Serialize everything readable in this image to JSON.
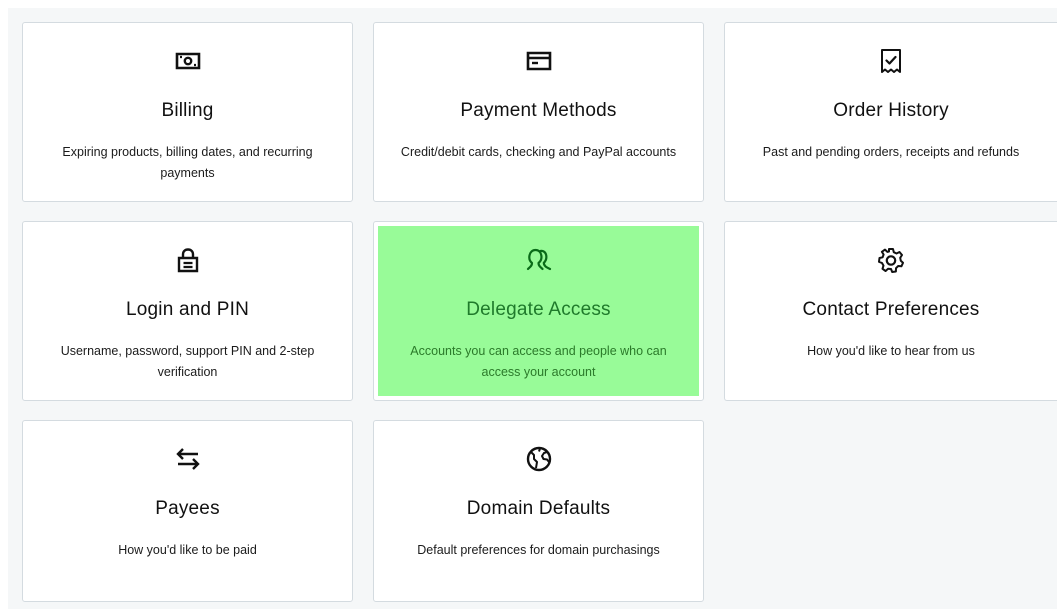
{
  "cards": [
    {
      "title": "Billing",
      "description": "Expiring products, billing dates, and recurring payments",
      "icon": "cash-icon"
    },
    {
      "title": "Payment Methods",
      "description": "Credit/debit cards, checking and PayPal accounts",
      "icon": "credit-card-icon"
    },
    {
      "title": "Order History",
      "description": "Past and pending orders, receipts and refunds",
      "icon": "receipt-check-icon"
    },
    {
      "title": "Login and PIN",
      "description": "Username, password, support PIN and 2-step verification",
      "icon": "lock-icon"
    },
    {
      "title": "Delegate Access",
      "description": "Accounts you can access and people who can access your account",
      "icon": "people-icon",
      "highlighted": true,
      "highlight_color": "#98fb98"
    },
    {
      "title": "Contact Preferences",
      "description": "How you'd like to hear from us",
      "icon": "gear-icon"
    },
    {
      "title": "Payees",
      "description": "How you'd like to be paid",
      "icon": "transfer-arrows-icon"
    },
    {
      "title": "Domain Defaults",
      "description": "Default preferences for domain purchasings",
      "icon": "globe-icon"
    }
  ],
  "colors": {
    "page_background": "#f5f7f8",
    "card_background": "#ffffff",
    "card_border": "#d4dbe0",
    "highlight": "#98fb98",
    "highlight_text": "#1f7a2b"
  }
}
